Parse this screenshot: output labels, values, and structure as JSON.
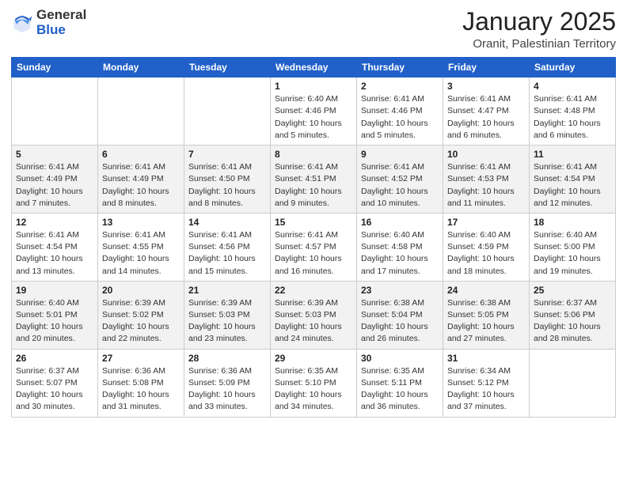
{
  "header": {
    "logo_general": "General",
    "logo_blue": "Blue",
    "main_title": "January 2025",
    "subtitle": "Oranit, Palestinian Territory"
  },
  "weekdays": [
    "Sunday",
    "Monday",
    "Tuesday",
    "Wednesday",
    "Thursday",
    "Friday",
    "Saturday"
  ],
  "weeks": [
    [
      {
        "day": "",
        "info": ""
      },
      {
        "day": "",
        "info": ""
      },
      {
        "day": "",
        "info": ""
      },
      {
        "day": "1",
        "info": "Sunrise: 6:40 AM\nSunset: 4:46 PM\nDaylight: 10 hours\nand 5 minutes."
      },
      {
        "day": "2",
        "info": "Sunrise: 6:41 AM\nSunset: 4:46 PM\nDaylight: 10 hours\nand 5 minutes."
      },
      {
        "day": "3",
        "info": "Sunrise: 6:41 AM\nSunset: 4:47 PM\nDaylight: 10 hours\nand 6 minutes."
      },
      {
        "day": "4",
        "info": "Sunrise: 6:41 AM\nSunset: 4:48 PM\nDaylight: 10 hours\nand 6 minutes."
      }
    ],
    [
      {
        "day": "5",
        "info": "Sunrise: 6:41 AM\nSunset: 4:49 PM\nDaylight: 10 hours\nand 7 minutes."
      },
      {
        "day": "6",
        "info": "Sunrise: 6:41 AM\nSunset: 4:49 PM\nDaylight: 10 hours\nand 8 minutes."
      },
      {
        "day": "7",
        "info": "Sunrise: 6:41 AM\nSunset: 4:50 PM\nDaylight: 10 hours\nand 8 minutes."
      },
      {
        "day": "8",
        "info": "Sunrise: 6:41 AM\nSunset: 4:51 PM\nDaylight: 10 hours\nand 9 minutes."
      },
      {
        "day": "9",
        "info": "Sunrise: 6:41 AM\nSunset: 4:52 PM\nDaylight: 10 hours\nand 10 minutes."
      },
      {
        "day": "10",
        "info": "Sunrise: 6:41 AM\nSunset: 4:53 PM\nDaylight: 10 hours\nand 11 minutes."
      },
      {
        "day": "11",
        "info": "Sunrise: 6:41 AM\nSunset: 4:54 PM\nDaylight: 10 hours\nand 12 minutes."
      }
    ],
    [
      {
        "day": "12",
        "info": "Sunrise: 6:41 AM\nSunset: 4:54 PM\nDaylight: 10 hours\nand 13 minutes."
      },
      {
        "day": "13",
        "info": "Sunrise: 6:41 AM\nSunset: 4:55 PM\nDaylight: 10 hours\nand 14 minutes."
      },
      {
        "day": "14",
        "info": "Sunrise: 6:41 AM\nSunset: 4:56 PM\nDaylight: 10 hours\nand 15 minutes."
      },
      {
        "day": "15",
        "info": "Sunrise: 6:41 AM\nSunset: 4:57 PM\nDaylight: 10 hours\nand 16 minutes."
      },
      {
        "day": "16",
        "info": "Sunrise: 6:40 AM\nSunset: 4:58 PM\nDaylight: 10 hours\nand 17 minutes."
      },
      {
        "day": "17",
        "info": "Sunrise: 6:40 AM\nSunset: 4:59 PM\nDaylight: 10 hours\nand 18 minutes."
      },
      {
        "day": "18",
        "info": "Sunrise: 6:40 AM\nSunset: 5:00 PM\nDaylight: 10 hours\nand 19 minutes."
      }
    ],
    [
      {
        "day": "19",
        "info": "Sunrise: 6:40 AM\nSunset: 5:01 PM\nDaylight: 10 hours\nand 20 minutes."
      },
      {
        "day": "20",
        "info": "Sunrise: 6:39 AM\nSunset: 5:02 PM\nDaylight: 10 hours\nand 22 minutes."
      },
      {
        "day": "21",
        "info": "Sunrise: 6:39 AM\nSunset: 5:03 PM\nDaylight: 10 hours\nand 23 minutes."
      },
      {
        "day": "22",
        "info": "Sunrise: 6:39 AM\nSunset: 5:03 PM\nDaylight: 10 hours\nand 24 minutes."
      },
      {
        "day": "23",
        "info": "Sunrise: 6:38 AM\nSunset: 5:04 PM\nDaylight: 10 hours\nand 26 minutes."
      },
      {
        "day": "24",
        "info": "Sunrise: 6:38 AM\nSunset: 5:05 PM\nDaylight: 10 hours\nand 27 minutes."
      },
      {
        "day": "25",
        "info": "Sunrise: 6:37 AM\nSunset: 5:06 PM\nDaylight: 10 hours\nand 28 minutes."
      }
    ],
    [
      {
        "day": "26",
        "info": "Sunrise: 6:37 AM\nSunset: 5:07 PM\nDaylight: 10 hours\nand 30 minutes."
      },
      {
        "day": "27",
        "info": "Sunrise: 6:36 AM\nSunset: 5:08 PM\nDaylight: 10 hours\nand 31 minutes."
      },
      {
        "day": "28",
        "info": "Sunrise: 6:36 AM\nSunset: 5:09 PM\nDaylight: 10 hours\nand 33 minutes."
      },
      {
        "day": "29",
        "info": "Sunrise: 6:35 AM\nSunset: 5:10 PM\nDaylight: 10 hours\nand 34 minutes."
      },
      {
        "day": "30",
        "info": "Sunrise: 6:35 AM\nSunset: 5:11 PM\nDaylight: 10 hours\nand 36 minutes."
      },
      {
        "day": "31",
        "info": "Sunrise: 6:34 AM\nSunset: 5:12 PM\nDaylight: 10 hours\nand 37 minutes."
      },
      {
        "day": "",
        "info": ""
      }
    ]
  ]
}
